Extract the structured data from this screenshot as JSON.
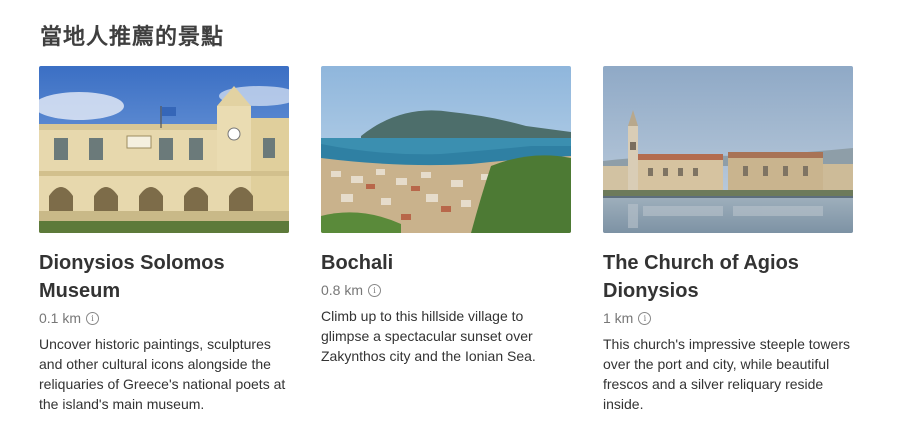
{
  "section": {
    "title": "當地人推薦的景點"
  },
  "cards": [
    {
      "title": "Dionysios Solomos Museum",
      "distance": "0.1 km",
      "description": "Uncover historic paintings, sculptures and other cultural icons alongside the reliquaries of Greece's national poets at the island's main museum."
    },
    {
      "title": "Bochali",
      "distance": "0.8 km",
      "description": "Climb up to this hillside village to glimpse a spectacular sunset over Zakynthos city and the Ionian Sea."
    },
    {
      "title": "The Church of Agios Dionysios",
      "distance": "1 km",
      "description": "This church's impressive steeple towers over the port and city, while beautiful frescos and a silver reliquary reside inside."
    }
  ],
  "icons": {
    "info": "info-icon"
  },
  "colors": {
    "title": "#3f3f3f",
    "text": "#333333",
    "muted": "#777777"
  }
}
